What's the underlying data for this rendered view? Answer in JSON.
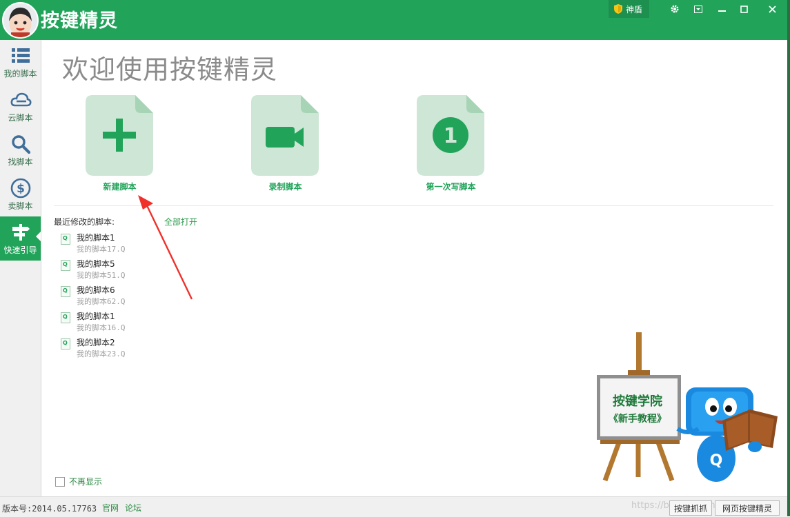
{
  "app": {
    "title": "按键精灵",
    "shield_label": "神盾",
    "brand_color": "#22a35a"
  },
  "window_controls": {
    "settings_icon": "gear-icon",
    "menu_icon": "dropdown-menu-icon",
    "minimize_icon": "minimize-icon",
    "maximize_icon": "maximize-icon",
    "close_icon": "close-icon"
  },
  "sidebar": {
    "items": [
      {
        "label": "我的脚本",
        "icon": "list-icon"
      },
      {
        "label": "云脚本",
        "icon": "cloud-icon"
      },
      {
        "label": "找脚本",
        "icon": "search-icon"
      },
      {
        "label": "卖脚本",
        "icon": "dollar-icon"
      },
      {
        "label": "快速引导",
        "icon": "signpost-icon",
        "active": true
      }
    ]
  },
  "main": {
    "welcome": "欢迎使用按键精灵",
    "cards": [
      {
        "label": "新建脚本",
        "icon": "plus-icon"
      },
      {
        "label": "录制脚本",
        "icon": "video-camera-icon"
      },
      {
        "label": "第一次写脚本",
        "icon": "number-one-icon",
        "badge": "1"
      }
    ],
    "recent_title": "最近修改的脚本:",
    "open_all": "全部打开",
    "recent": [
      {
        "name": "我的脚本1",
        "file": "我的脚本17.Q"
      },
      {
        "name": "我的脚本5",
        "file": "我的脚本51.Q"
      },
      {
        "name": "我的脚本6",
        "file": "我的脚本62.Q"
      },
      {
        "name": "我的脚本1",
        "file": "我的脚本16.Q"
      },
      {
        "name": "我的脚本2",
        "file": "我的脚本23.Q"
      }
    ],
    "file_icon_letter": "Q",
    "no_show": "不再显示",
    "academy": {
      "line1": "按键学院",
      "line2": "《新手教程》",
      "mascot_letter": "Q"
    }
  },
  "statusbar": {
    "version": "版本号:2014.05.17763",
    "official_site": "官网",
    "forum": "论坛",
    "watermark": "https://blog.csdn.net/qq_41...",
    "btn_capture": "按键抓抓",
    "btn_web": "网页按键精灵"
  }
}
